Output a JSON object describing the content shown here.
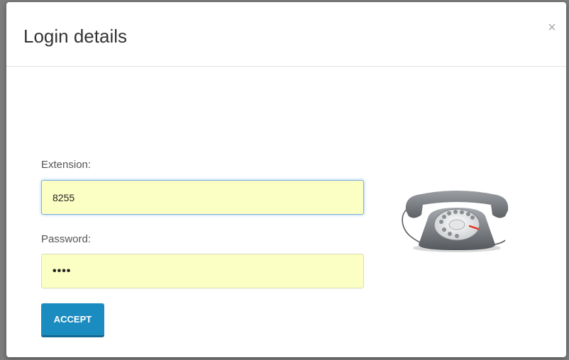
{
  "dialog": {
    "title": "Login details",
    "close_glyph": "×",
    "close_icon": "close-icon"
  },
  "form": {
    "extension": {
      "label": "Extension:",
      "value": "8255"
    },
    "password": {
      "label": "Password:",
      "value": "••••"
    },
    "accept_label": "ACCEPT"
  },
  "illustration": {
    "icon": "rotary-telephone-icon"
  },
  "colors": {
    "accent": "#1b8cc0",
    "input_autofill": "#fbffc4",
    "phone_body": "#7a7d82",
    "dial_marker": "#e0321e"
  }
}
